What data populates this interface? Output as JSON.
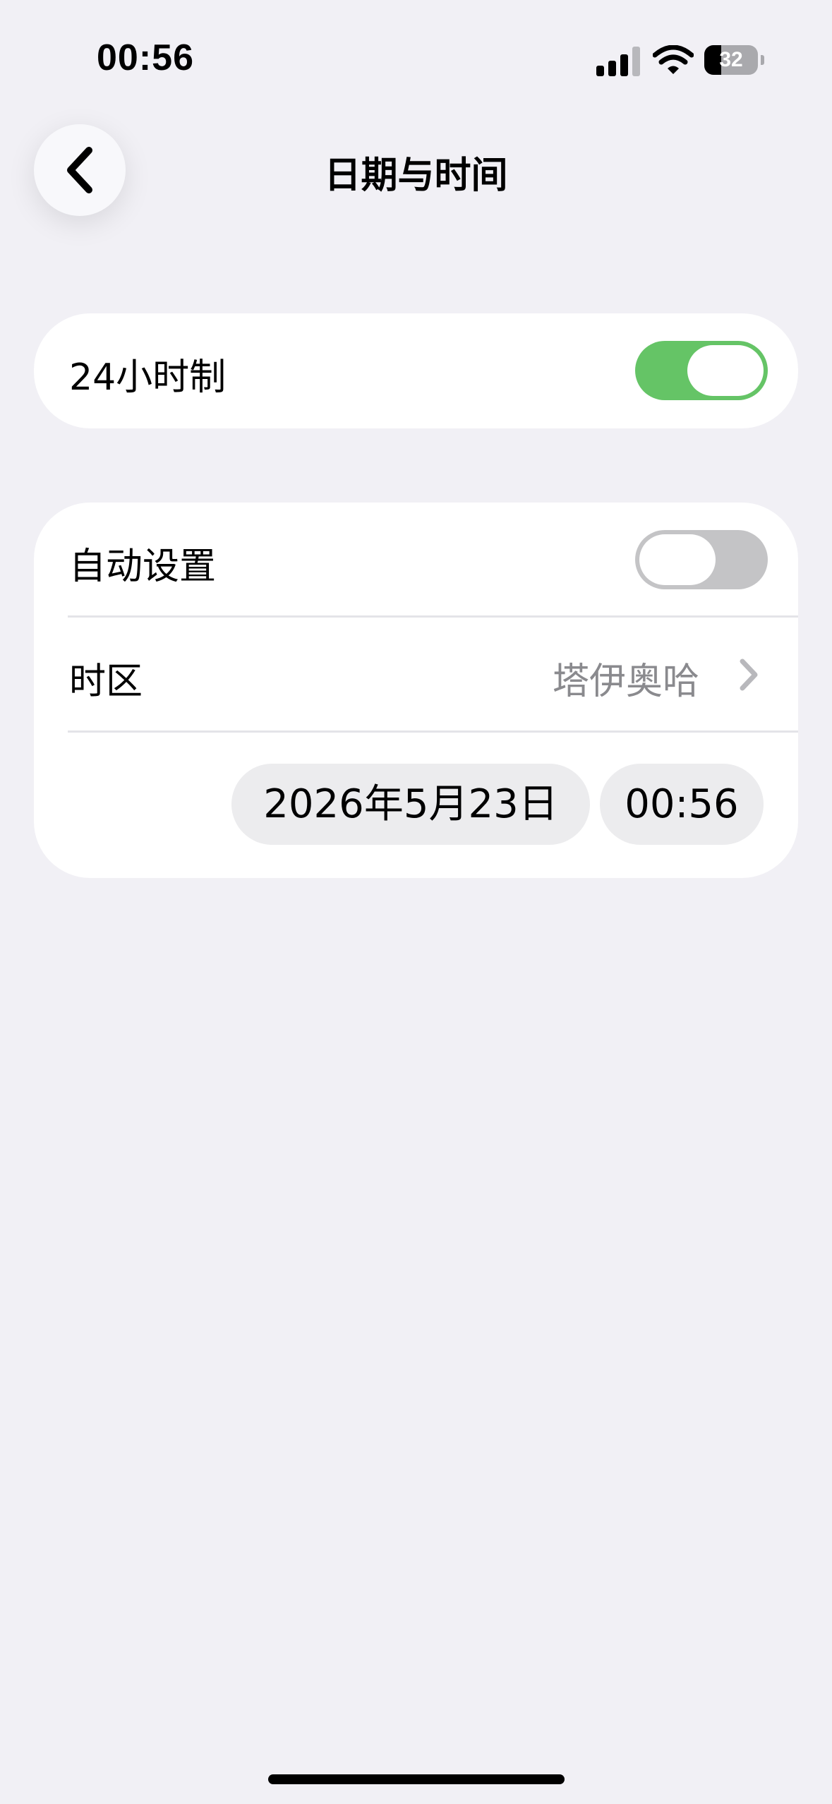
{
  "status_bar": {
    "time": "00:56",
    "battery_level": "32",
    "battery_percent": 32,
    "signal_icon": "cellular-signal-icon",
    "wifi_icon": "wifi-icon",
    "battery_icon": "battery-icon"
  },
  "header": {
    "title": "日期与时间",
    "back_icon": "chevron-left-icon"
  },
  "settings": {
    "format_24h": {
      "label": "24小时制",
      "enabled": true
    },
    "auto_set": {
      "label": "自动设置",
      "enabled": false
    },
    "timezone": {
      "label": "时区",
      "value": "塔伊奥哈",
      "icon": "chevron-right-icon"
    },
    "date_value": "2026年5月23日",
    "time_value": "00:56"
  },
  "colors": {
    "background": "#f1f0f5",
    "card": "#ffffff",
    "toggle_on": "#65c466",
    "toggle_off": "#c4c4c6",
    "secondary_text": "#8a8a8e",
    "pill": "#ececee"
  }
}
